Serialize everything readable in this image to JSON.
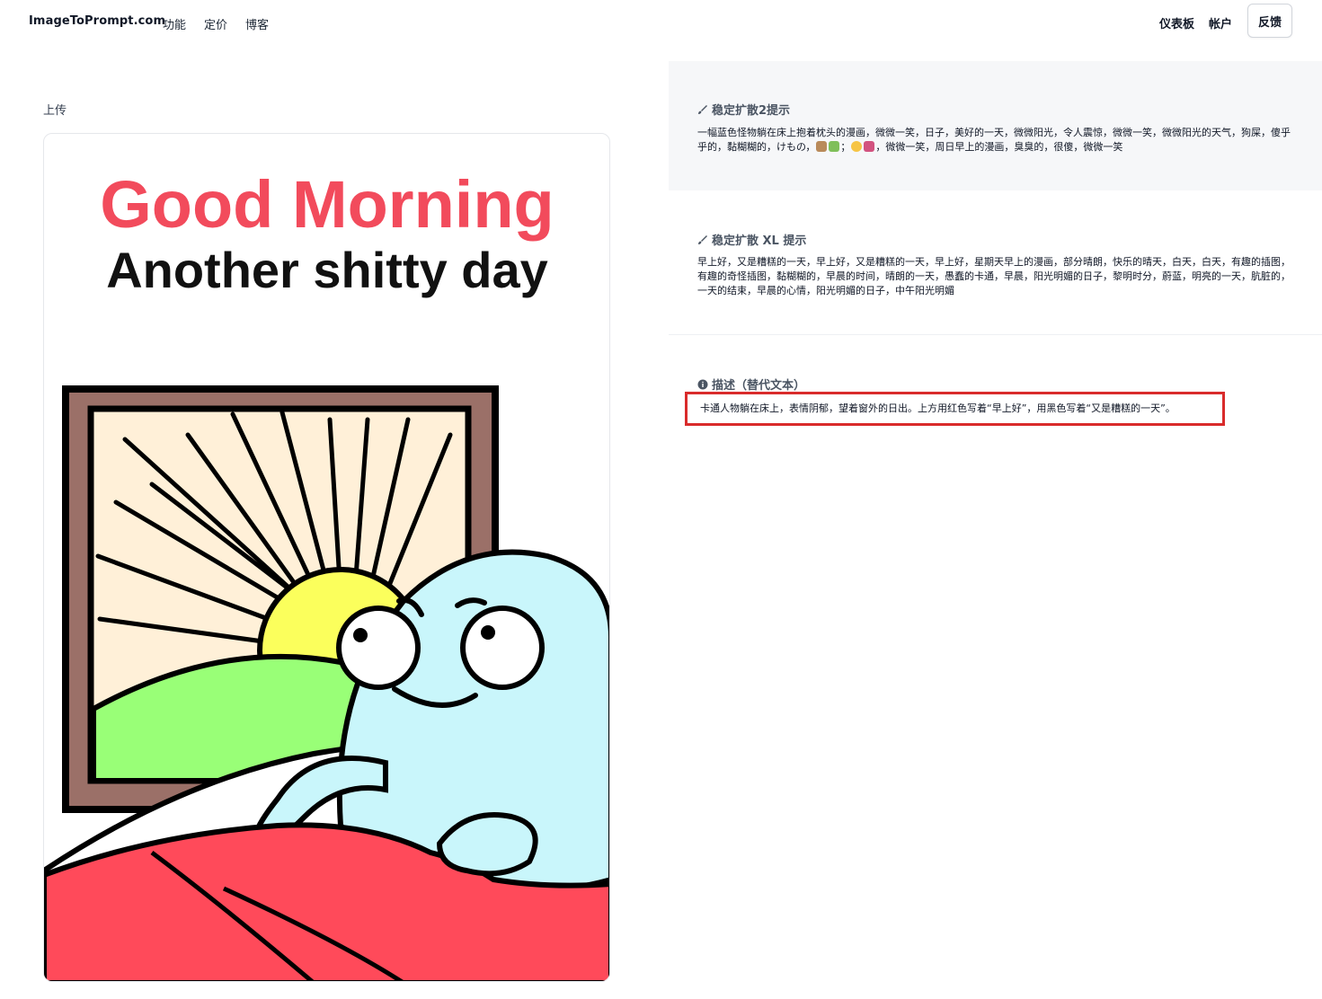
{
  "nav": {
    "brand": "ImageToPrompt.com",
    "links": [
      "功能",
      "定价",
      "博客"
    ],
    "dashboard": "仪表板",
    "account": "帐户",
    "feedback": "反馈"
  },
  "upload": {
    "label": "上传",
    "image_caption_line1": "Good Morning",
    "image_caption_line2": "Another shitty day"
  },
  "panels": {
    "sd2": {
      "title": "稳定扩散2提示",
      "text_part1": "一幅蓝色怪物躺在床上抱着枕头的漫画，微微一笑，日子，美好的一天，微微阳光，令人震惊，微微一笑，微微阳光的天气，狗屎，傻乎乎的，黏糊糊的，けもの，",
      "text_part2": "；",
      "text_part3": "，微微一笑，周日早上的漫画，臭臭的，很傻，微微一笑"
    },
    "sdxl": {
      "title": "稳定扩散 XL 提示",
      "text": "早上好，又是糟糕的一天，早上好，又是糟糕的一天，早上好，星期天早上的漫画，部分晴朗，快乐的晴天，白天，白天，有趣的插图，有趣的奇怪插图，黏糊糊的，早晨的时间，晴朗的一天，愚蠢的卡通，早晨，阳光明媚的日子，黎明时分，蔚蓝，明亮的一天，肮脏的，一天的结束，早晨的心情，阳光明媚的日子，中午阳光明媚"
    },
    "desc": {
      "title": "描述（替代文本）",
      "text": "卡通人物躺在床上，表情阴郁，望着窗外的日出。上方用红色写着“早上好”，用黑色写着“又是糟糕的一天”。"
    }
  },
  "colors": {
    "title_red": "#f24b5c",
    "highlight_border": "#d92b2b",
    "monster_blue": "#c9f6fb",
    "sun_yellow": "#fbff5c",
    "hill_green": "#99ff77",
    "blanket_red": "#ff4a5a",
    "window_frame": "#9b7068",
    "sky": "#fff0d8"
  }
}
